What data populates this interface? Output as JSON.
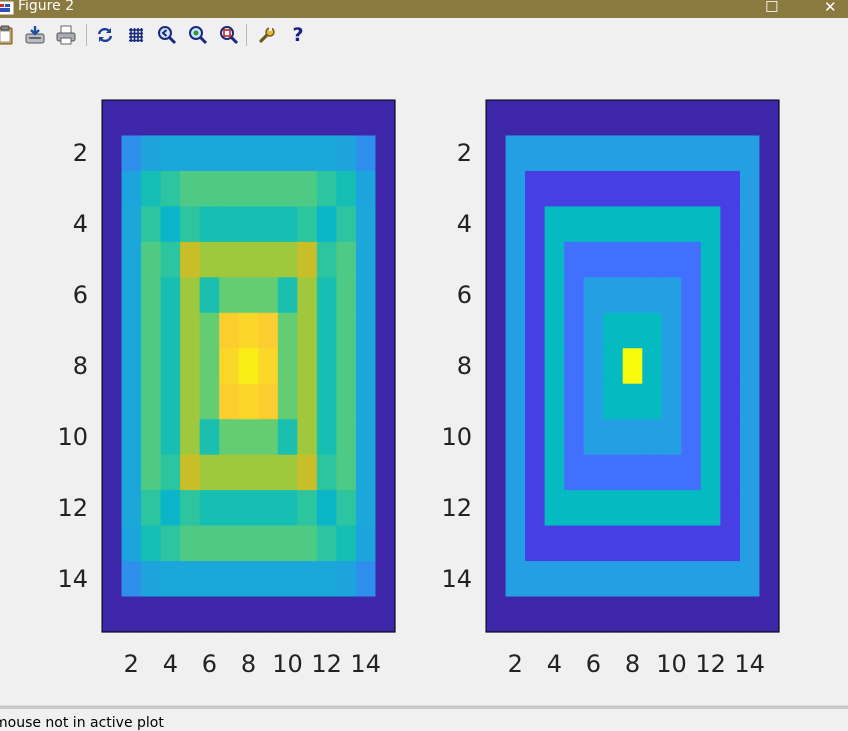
{
  "window": {
    "title": "Figure 2",
    "maximize_glyph": "☐",
    "close_glyph": "✕"
  },
  "toolbar": {
    "buttons": [
      {
        "name": "copy-clipboard-button",
        "icon": "clipboard-icon"
      },
      {
        "name": "export-button",
        "icon": "export-icon"
      },
      {
        "name": "print-button",
        "icon": "printer-icon"
      },
      {
        "name": "refresh-button",
        "icon": "refresh-icon"
      },
      {
        "name": "grid-button",
        "icon": "grid-icon"
      },
      {
        "name": "zoom-out-button",
        "icon": "zoom-out-icon"
      },
      {
        "name": "zoom-in-button",
        "icon": "zoom-in-icon"
      },
      {
        "name": "zoom-fit-button",
        "icon": "zoom-fit-icon"
      },
      {
        "name": "settings-button",
        "icon": "wrench-icon"
      },
      {
        "name": "help-button",
        "icon": "help-icon"
      }
    ],
    "help_glyph": "?"
  },
  "status": {
    "text": "mouse not in active plot"
  },
  "colors": {
    "titlebar": "#8b7a3f",
    "toolbar_bg": "#f0f0f0",
    "plot_border": "#000000"
  },
  "chart_data": [
    {
      "type": "heatmap",
      "colormap": "parula",
      "x_ticks": [
        2,
        4,
        6,
        8,
        10,
        12,
        14
      ],
      "y_ticks": [
        2,
        4,
        6,
        8,
        10,
        12,
        14
      ],
      "xlim": [
        0.5,
        15.5
      ],
      "ylim": [
        0.5,
        15.5
      ],
      "y_reversed": true,
      "clim": [
        0,
        1
      ],
      "z": [
        [
          0,
          0,
          0,
          0,
          0,
          0,
          0,
          0,
          0,
          0,
          0,
          0,
          0,
          0,
          0
        ],
        [
          0,
          0.23,
          0.28,
          0.29,
          0.29,
          0.29,
          0.29,
          0.29,
          0.29,
          0.29,
          0.29,
          0.29,
          0.28,
          0.23,
          0
        ],
        [
          0,
          0.28,
          0.4,
          0.47,
          0.52,
          0.52,
          0.52,
          0.52,
          0.52,
          0.52,
          0.52,
          0.47,
          0.4,
          0.28,
          0
        ],
        [
          0,
          0.29,
          0.47,
          0.34,
          0.47,
          0.41,
          0.41,
          0.41,
          0.41,
          0.41,
          0.47,
          0.34,
          0.47,
          0.29,
          0
        ],
        [
          0,
          0.29,
          0.52,
          0.47,
          0.72,
          0.62,
          0.62,
          0.62,
          0.62,
          0.62,
          0.72,
          0.47,
          0.52,
          0.29,
          0
        ],
        [
          0,
          0.29,
          0.52,
          0.41,
          0.62,
          0.42,
          0.55,
          0.55,
          0.55,
          0.42,
          0.62,
          0.41,
          0.52,
          0.29,
          0
        ],
        [
          0,
          0.29,
          0.52,
          0.41,
          0.62,
          0.55,
          0.85,
          0.88,
          0.85,
          0.55,
          0.62,
          0.41,
          0.52,
          0.29,
          0
        ],
        [
          0,
          0.29,
          0.52,
          0.41,
          0.62,
          0.55,
          0.88,
          0.96,
          0.88,
          0.55,
          0.62,
          0.41,
          0.52,
          0.29,
          0
        ],
        [
          0,
          0.29,
          0.52,
          0.41,
          0.62,
          0.55,
          0.85,
          0.88,
          0.85,
          0.55,
          0.62,
          0.41,
          0.52,
          0.29,
          0
        ],
        [
          0,
          0.29,
          0.52,
          0.41,
          0.62,
          0.42,
          0.55,
          0.55,
          0.55,
          0.42,
          0.62,
          0.41,
          0.52,
          0.29,
          0
        ],
        [
          0,
          0.29,
          0.52,
          0.47,
          0.72,
          0.62,
          0.62,
          0.62,
          0.62,
          0.62,
          0.72,
          0.47,
          0.52,
          0.29,
          0
        ],
        [
          0,
          0.29,
          0.47,
          0.34,
          0.47,
          0.41,
          0.41,
          0.41,
          0.41,
          0.41,
          0.47,
          0.34,
          0.47,
          0.29,
          0
        ],
        [
          0,
          0.28,
          0.4,
          0.47,
          0.52,
          0.52,
          0.52,
          0.52,
          0.52,
          0.52,
          0.52,
          0.47,
          0.4,
          0.28,
          0
        ],
        [
          0,
          0.23,
          0.28,
          0.29,
          0.29,
          0.29,
          0.29,
          0.29,
          0.29,
          0.29,
          0.29,
          0.29,
          0.28,
          0.23,
          0
        ],
        [
          0,
          0,
          0,
          0,
          0,
          0,
          0,
          0,
          0,
          0,
          0,
          0,
          0,
          0,
          0
        ]
      ]
    },
    {
      "type": "heatmap",
      "colormap": "parula",
      "x_ticks": [
        2,
        4,
        6,
        8,
        10,
        12,
        14
      ],
      "y_ticks": [
        2,
        4,
        6,
        8,
        10,
        12,
        14
      ],
      "xlim": [
        0.5,
        15.5
      ],
      "ylim": [
        0.5,
        15.5
      ],
      "y_reversed": true,
      "clim": [
        0,
        1
      ],
      "z": [
        [
          0,
          0,
          0,
          0,
          0,
          0,
          0,
          0,
          0,
          0,
          0,
          0,
          0,
          0,
          0
        ],
        [
          0,
          0.26,
          0.26,
          0.26,
          0.26,
          0.26,
          0.26,
          0.26,
          0.26,
          0.26,
          0.26,
          0.26,
          0.26,
          0.26,
          0
        ],
        [
          0,
          0.26,
          0.08,
          0.08,
          0.08,
          0.08,
          0.08,
          0.08,
          0.08,
          0.08,
          0.08,
          0.08,
          0.08,
          0.26,
          0
        ],
        [
          0,
          0.26,
          0.08,
          0.36,
          0.36,
          0.36,
          0.36,
          0.36,
          0.36,
          0.36,
          0.36,
          0.36,
          0.08,
          0.26,
          0
        ],
        [
          0,
          0.26,
          0.08,
          0.36,
          0.17,
          0.17,
          0.17,
          0.17,
          0.17,
          0.17,
          0.17,
          0.36,
          0.08,
          0.26,
          0
        ],
        [
          0,
          0.26,
          0.08,
          0.36,
          0.17,
          0.26,
          0.26,
          0.26,
          0.26,
          0.26,
          0.17,
          0.36,
          0.08,
          0.26,
          0
        ],
        [
          0,
          0.26,
          0.08,
          0.36,
          0.17,
          0.26,
          0.36,
          0.36,
          0.36,
          0.26,
          0.17,
          0.36,
          0.08,
          0.26,
          0
        ],
        [
          0,
          0.26,
          0.08,
          0.36,
          0.17,
          0.26,
          0.36,
          1,
          0.36,
          0.26,
          0.17,
          0.36,
          0.08,
          0.26,
          0
        ],
        [
          0,
          0.26,
          0.08,
          0.36,
          0.17,
          0.26,
          0.36,
          0.36,
          0.36,
          0.26,
          0.17,
          0.36,
          0.08,
          0.26,
          0
        ],
        [
          0,
          0.26,
          0.08,
          0.36,
          0.17,
          0.26,
          0.26,
          0.26,
          0.26,
          0.26,
          0.17,
          0.36,
          0.08,
          0.26,
          0
        ],
        [
          0,
          0.26,
          0.08,
          0.36,
          0.17,
          0.17,
          0.17,
          0.17,
          0.17,
          0.17,
          0.17,
          0.36,
          0.08,
          0.26,
          0
        ],
        [
          0,
          0.26,
          0.08,
          0.36,
          0.36,
          0.36,
          0.36,
          0.36,
          0.36,
          0.36,
          0.36,
          0.36,
          0.08,
          0.26,
          0
        ],
        [
          0,
          0.26,
          0.08,
          0.08,
          0.08,
          0.08,
          0.08,
          0.08,
          0.08,
          0.08,
          0.08,
          0.08,
          0.08,
          0.26,
          0
        ],
        [
          0,
          0.26,
          0.26,
          0.26,
          0.26,
          0.26,
          0.26,
          0.26,
          0.26,
          0.26,
          0.26,
          0.26,
          0.26,
          0.26,
          0
        ],
        [
          0,
          0,
          0,
          0,
          0,
          0,
          0,
          0,
          0,
          0,
          0,
          0,
          0,
          0,
          0
        ]
      ]
    }
  ]
}
